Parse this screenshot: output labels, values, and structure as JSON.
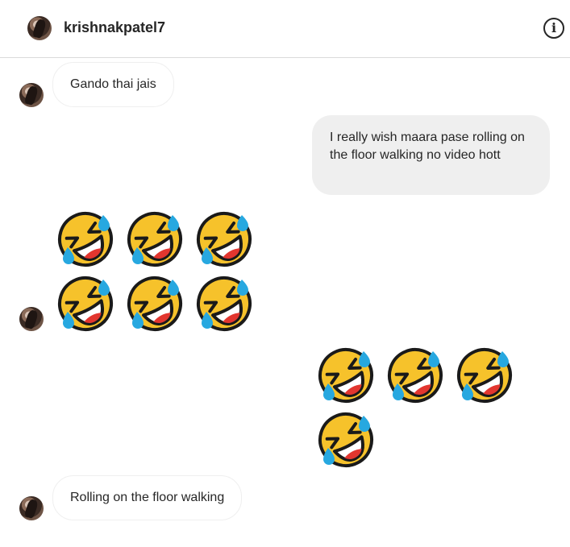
{
  "header": {
    "username": "krishnakpatel7",
    "info_icon": "ⓘ"
  },
  "messages": [
    {
      "direction": "incoming",
      "type": "text",
      "text": "Gando thai jais"
    },
    {
      "direction": "outgoing",
      "type": "text",
      "text": "I really wish maara pase rolling on the floor walking no video hott"
    },
    {
      "direction": "incoming",
      "type": "emoji",
      "emoji": "rolling-on-the-floor-laughing",
      "count": 6
    },
    {
      "direction": "outgoing",
      "type": "emoji",
      "emoji": "rolling-on-the-floor-laughing",
      "count": 4
    },
    {
      "direction": "incoming",
      "type": "text",
      "text": "Rolling on the floor walking"
    }
  ],
  "colors": {
    "emoji_face": "#f6c22b",
    "emoji_tear": "#27a8e0",
    "outgoing_bubble": "#efefef",
    "divider": "#dbdbdb"
  }
}
